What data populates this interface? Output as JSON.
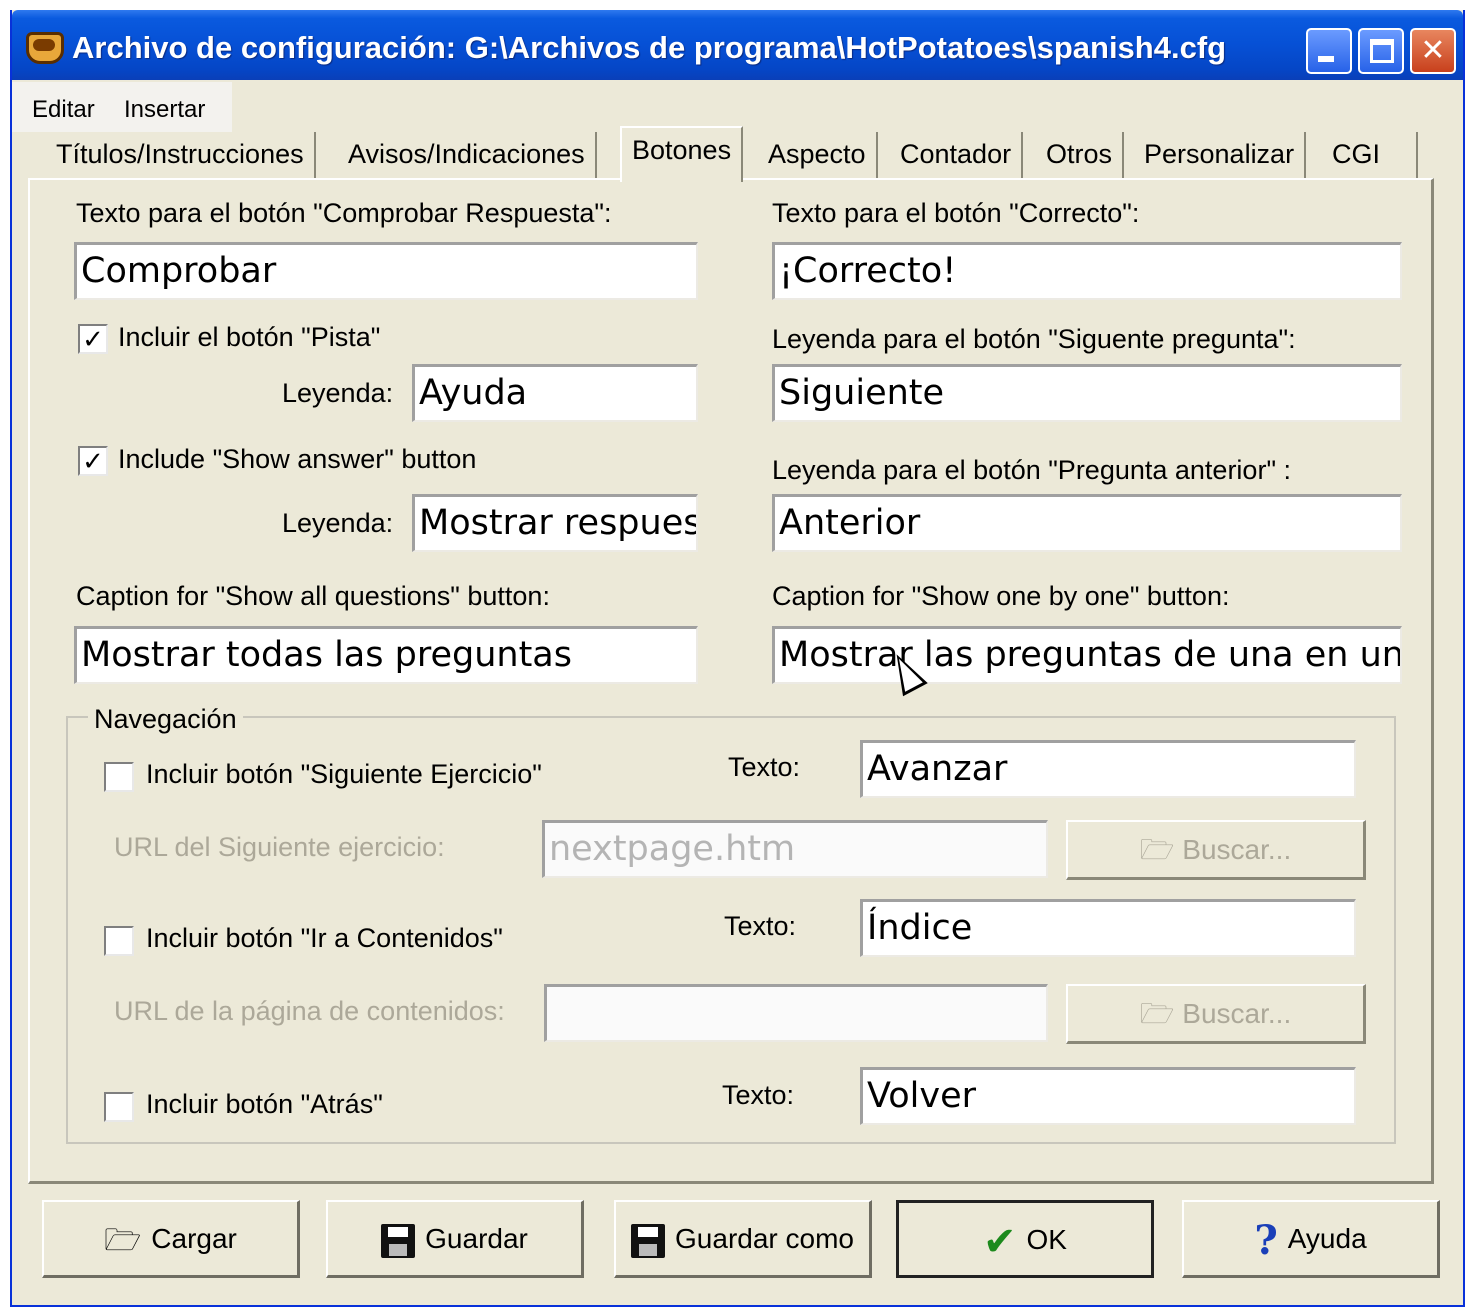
{
  "window": {
    "title": "Archivo de configuración: G:\\Archivos de programa\\HotPotatoes\\spanish4.cfg"
  },
  "menu": [
    "Editar",
    "Insertar"
  ],
  "tabs": [
    "Títulos/Instrucciones",
    "Avisos/Indicaciones",
    "Botones",
    "Aspecto",
    "Contador",
    "Otros",
    "Personalizar",
    "CGI"
  ],
  "active_tab": "Botones",
  "botones": {
    "check_label": "Texto para el botón \"Comprobar Respuesta\":",
    "check_value": "Comprobar",
    "correct_label": "Texto para el botón \"Correcto\":",
    "correct_value": "¡Correcto!",
    "hint_checkbox": "Incluir el botón \"Pista\"",
    "hint_checked": true,
    "hint_caption_label": "Leyenda:",
    "hint_caption_value": "Ayuda",
    "next_q_label": "Leyenda para el botón \"Siguente pregunta\":",
    "next_q_value": "Siguiente",
    "show_answer_checkbox": "Include \"Show answer\" button",
    "show_answer_checked": true,
    "show_answer_caption_label": "Leyenda:",
    "show_answer_caption_value": "Mostrar respuest",
    "prev_q_label": "Leyenda para el botón \"Pregunta anterior\" :",
    "prev_q_value": "Anterior",
    "show_all_label": "Caption for \"Show all questions\" button:",
    "show_all_value": "Mostrar todas las preguntas",
    "show_one_label": "Caption for \"Show one by one\" button:",
    "show_one_value": "Mostrar las preguntas de una en una"
  },
  "navegacion": {
    "group_title": "Navegación",
    "next_ex_checkbox": "Incluir botón \"Siguiente Ejercicio\"",
    "next_ex_text_label": "Texto:",
    "next_ex_text_value": "Avanzar",
    "next_ex_url_label": "URL del Siguiente ejercicio:",
    "next_ex_url_value": "nextpage.htm",
    "browse_label": "Buscar...",
    "contents_checkbox": "Incluir botón \"Ir a Contenidos\"",
    "contents_text_label": "Texto:",
    "contents_text_value": "Índice",
    "contents_url_label": "URL de la página de contenidos:",
    "contents_url_value": "",
    "back_checkbox": "Incluir botón \"Atrás\"",
    "back_text_label": "Texto:",
    "back_text_value": "Volver"
  },
  "buttons": {
    "cargar": "Cargar",
    "guardar": "Guardar",
    "guardar_como": "Guardar como",
    "ok": "OK",
    "ayuda": "Ayuda"
  }
}
